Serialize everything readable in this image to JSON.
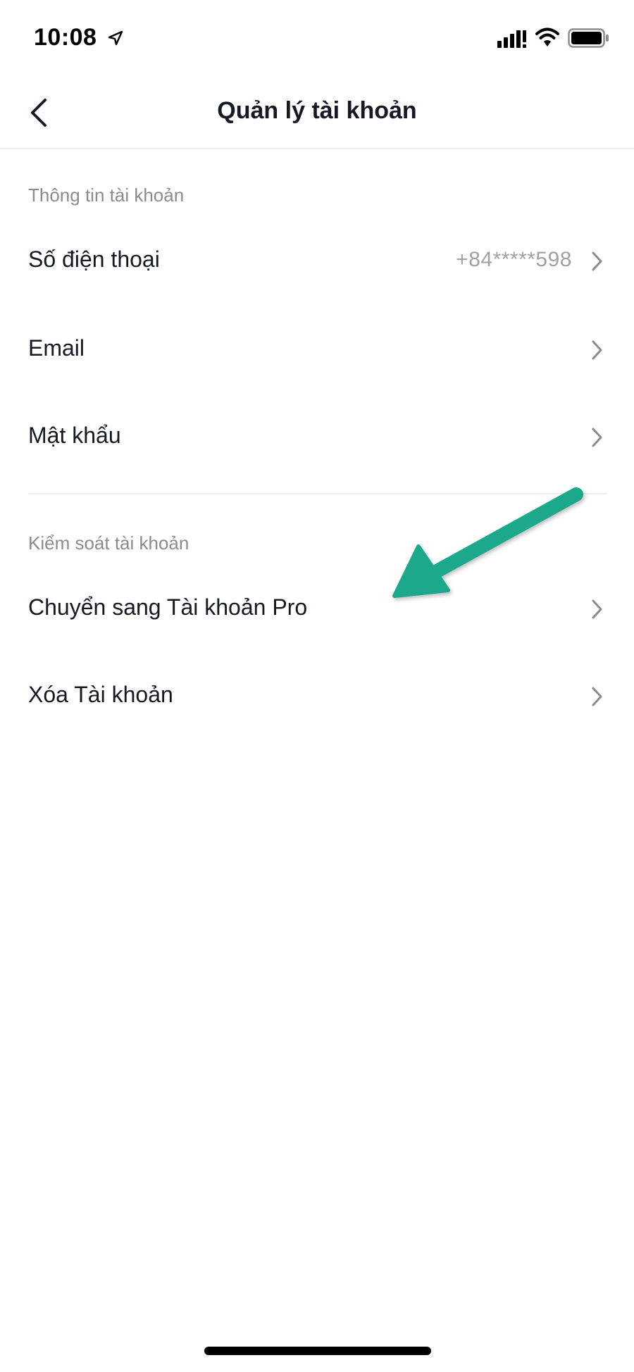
{
  "status_bar": {
    "time": "10:08",
    "icons": [
      "location-arrow-icon",
      "signal-icon",
      "wifi-icon",
      "battery-icon"
    ]
  },
  "nav": {
    "title": "Quản lý tài khoản",
    "back_icon": "chevron-left-icon"
  },
  "sections": {
    "account_info": {
      "header": "Thông tin tài khoản",
      "phone": {
        "label": "Số điện thoại",
        "value": "+84*****598"
      },
      "email": {
        "label": "Email"
      },
      "password": {
        "label": "Mật khẩu"
      }
    },
    "account_control": {
      "header": "Kiểm soát tài khoản",
      "switch_pro": {
        "label": "Chuyển sang Tài khoản Pro"
      },
      "delete": {
        "label": "Xóa Tài khoản"
      }
    }
  },
  "colors": {
    "annotation_arrow": "#1fa88a",
    "text_primary": "#161823",
    "text_secondary": "#8a8b91"
  }
}
